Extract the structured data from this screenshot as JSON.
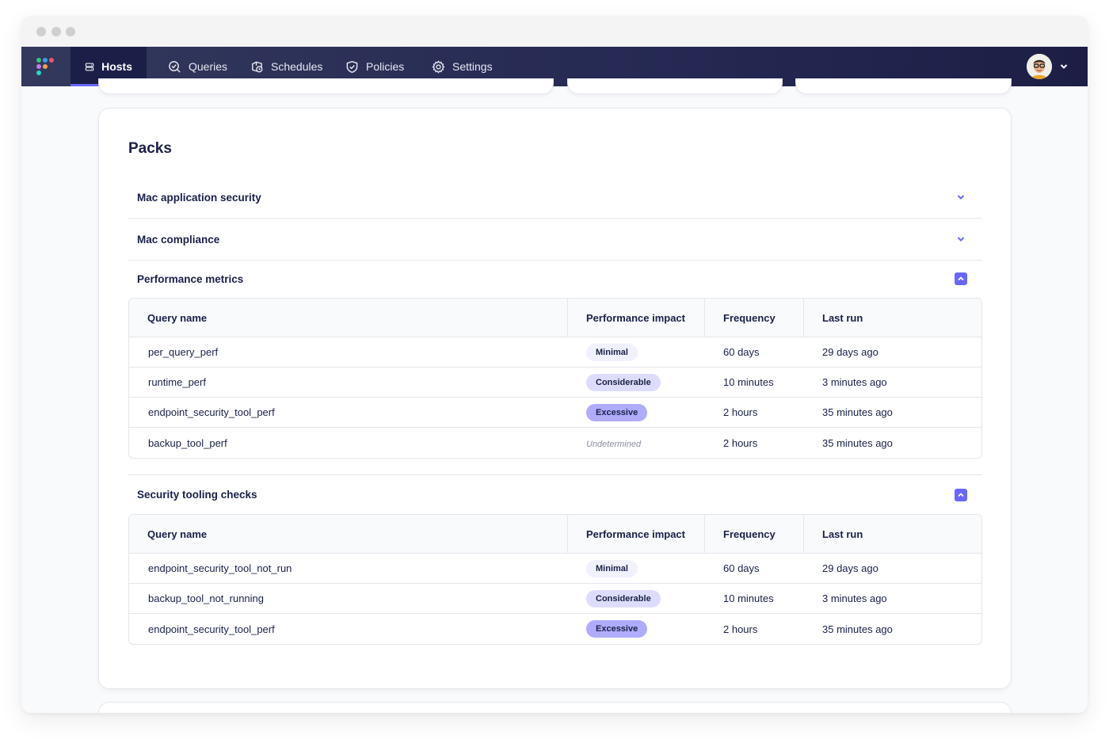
{
  "navbar": {
    "logo": "fleet-logo",
    "items": [
      {
        "label": "Hosts",
        "icon": "hosts-icon",
        "active": true
      },
      {
        "label": "Queries",
        "icon": "queries-icon",
        "active": false
      },
      {
        "label": "Schedules",
        "icon": "schedules-icon",
        "active": false
      },
      {
        "label": "Policies",
        "icon": "policies-icon",
        "active": false
      },
      {
        "label": "Settings",
        "icon": "settings-icon",
        "active": false
      }
    ],
    "user_menu_icon": "chevron-down-icon"
  },
  "colors": {
    "accent": "#6a67fe",
    "navbar": "#252953",
    "text": "#192147",
    "pill_minimal": "#f1f0ff",
    "pill_considerable": "#dedcfd",
    "pill_excessive": "#b0acfb"
  },
  "packs": {
    "title": "Packs",
    "columns": [
      "Query name",
      "Performance impact",
      "Frequency",
      "Last run"
    ],
    "sections": [
      {
        "label": "Mac application security",
        "expanded": false
      },
      {
        "label": "Mac compliance",
        "expanded": false
      },
      {
        "label": "Performance metrics",
        "expanded": true,
        "rows": [
          {
            "name": "per_query_perf",
            "impact": "Minimal",
            "frequency": "60 days",
            "last_run": "29 days ago"
          },
          {
            "name": "runtime_perf",
            "impact": "Considerable",
            "frequency": "10 minutes",
            "last_run": "3 minutes ago"
          },
          {
            "name": "endpoint_security_tool_perf",
            "impact": "Excessive",
            "frequency": "2 hours",
            "last_run": "35 minutes ago"
          },
          {
            "name": "backup_tool_perf",
            "impact": "Undetermined",
            "frequency": "2 hours",
            "last_run": "35 minutes ago"
          }
        ]
      },
      {
        "label": "Security tooling checks",
        "expanded": true,
        "rows": [
          {
            "name": "endpoint_security_tool_not_run",
            "impact": "Minimal",
            "frequency": "60 days",
            "last_run": "29 days ago"
          },
          {
            "name": "backup_tool_not_running",
            "impact": "Considerable",
            "frequency": "10 minutes",
            "last_run": "3 minutes ago"
          },
          {
            "name": "endpoint_security_tool_perf",
            "impact": "Excessive",
            "frequency": "2 hours",
            "last_run": "35 minutes ago"
          }
        ]
      }
    ]
  }
}
